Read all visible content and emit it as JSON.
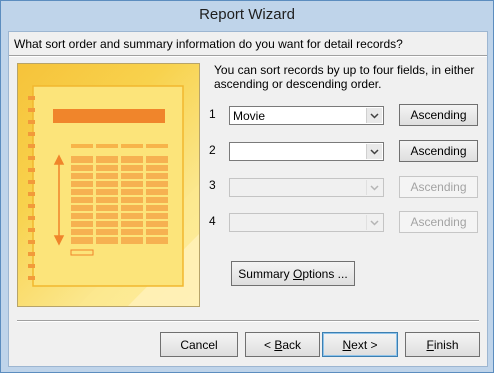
{
  "window": {
    "title": "Report Wizard"
  },
  "question": "What sort order and summary information do you want for detail records?",
  "instructions": "You can sort records by up to four fields, in either ascending or descending order.",
  "sort_rows": [
    {
      "number": "1",
      "field": "Movie",
      "order": "Ascending",
      "enabled": true
    },
    {
      "number": "2",
      "field": "",
      "order": "Ascending",
      "enabled": true
    },
    {
      "number": "3",
      "field": "",
      "order": "Ascending",
      "enabled": false
    },
    {
      "number": "4",
      "field": "",
      "order": "Ascending",
      "enabled": false
    }
  ],
  "summary_button": {
    "label_pre": "Summary ",
    "label_accel": "O",
    "label_post": "ptions ..."
  },
  "footer": {
    "cancel": "Cancel",
    "back_pre": "< ",
    "back_accel": "B",
    "back_post": "ack",
    "next_accel": "N",
    "next_post": "ext >",
    "finish_accel": "F",
    "finish_post": "inish"
  },
  "colors": {
    "accent_border": "#3c7fb1",
    "title_bar": "#bfd4ea",
    "illustration": "#f8d24d"
  },
  "icons": {
    "combo_arrow": "chevron-down-icon",
    "illustration": "report-layout-illustration"
  }
}
